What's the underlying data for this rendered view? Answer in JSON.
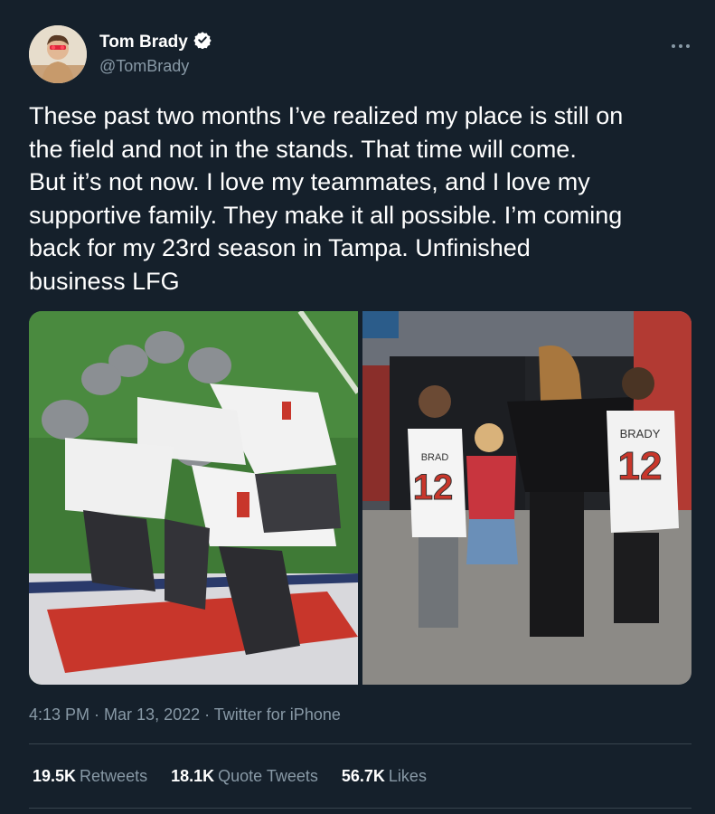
{
  "author": {
    "display_name": "Tom Brady",
    "handle": "@TomBrady",
    "verified": true
  },
  "more_icon": "more-horizontal-icon",
  "tweet": {
    "text": "These past two months I’ve realized my place is still on\nthe field and not in the stands. That time will come.\nBut it’s not now. I love my teammates, and I love my\nsupportive family. They make it all possible. I’m coming\nback for my 23rd season in Tampa. Unfinished\nbusiness LFG"
  },
  "media": {
    "left_jersey_number": "",
    "right": {
      "jersey_name_1": "BRADY",
      "jersey_number_1": "12",
      "jersey_name_2": "BRAD",
      "jersey_number_2": "12"
    }
  },
  "meta": {
    "time": "4:13 PM",
    "sep1": " · ",
    "date": "Mar 13, 2022",
    "sep2": " · ",
    "source": "Twitter for iPhone"
  },
  "stats": {
    "retweets_count": "19.5K",
    "retweets_label": "Retweets",
    "quotes_count": "18.1K",
    "quotes_label": "Quote Tweets",
    "likes_count": "56.7K",
    "likes_label": "Likes"
  },
  "colors": {
    "background": "#15202b",
    "secondary_text": "#8899a6",
    "verified_badge": "#ffffff",
    "divider": "#38444d"
  }
}
